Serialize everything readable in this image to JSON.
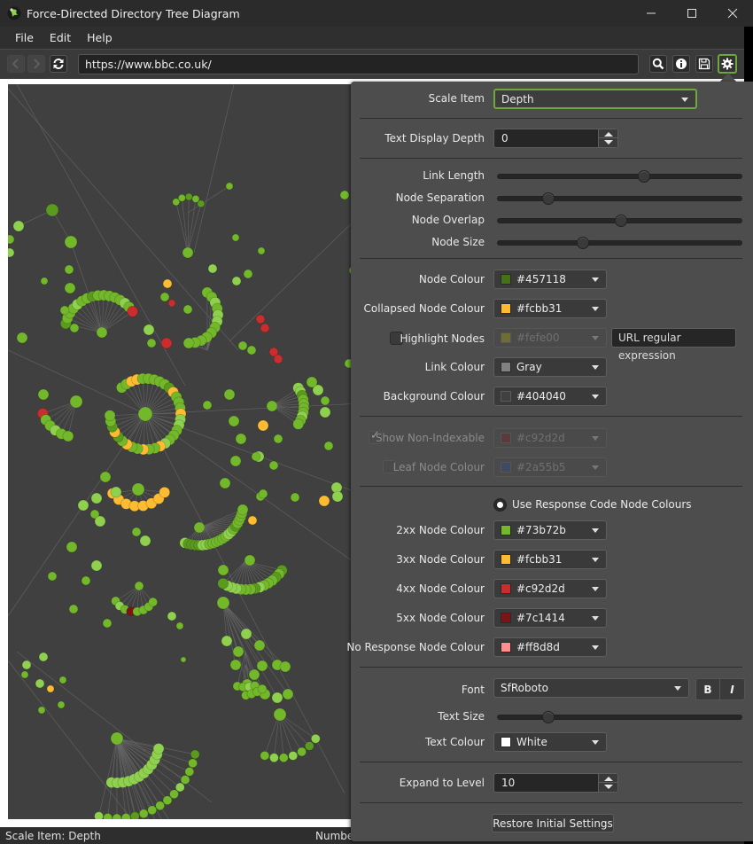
{
  "window": {
    "title": "Force-Directed Directory Tree Diagram",
    "controls": {
      "minimize": "—",
      "maximize": "☐",
      "close": "✕"
    }
  },
  "menu": [
    {
      "label": "File"
    },
    {
      "label": "Edit"
    },
    {
      "label": "Help"
    }
  ],
  "toolbar": {
    "back_icon": "‹",
    "forward_icon": "›",
    "url": "https://www.bbc.co.uk/",
    "icons": [
      "refresh-icon",
      "search-icon",
      "info-icon",
      "save-icon",
      "gear-icon"
    ]
  },
  "status": {
    "left": "Scale Item: Depth",
    "right": "Numbe"
  },
  "settings": {
    "scale_item": {
      "label": "Scale Item",
      "value": "Depth"
    },
    "text_display_depth": {
      "label": "Text Display Depth",
      "value": "0"
    },
    "sliders": [
      {
        "label": "Link Length",
        "value": 0.6
      },
      {
        "label": "Node Separation",
        "value": 0.19
      },
      {
        "label": "Node Overlap",
        "value": 0.5
      },
      {
        "label": "Node Size",
        "value": 0.34
      }
    ],
    "node_colour": {
      "label": "Node Colour",
      "value": "#457118",
      "swatch": "#457118"
    },
    "collapsed_node_colour": {
      "label": "Collapsed Node Colour",
      "value": "#fcbb31",
      "swatch": "#fcbb31"
    },
    "highlight_nodes": {
      "label": "Highlight Nodes",
      "checked": false,
      "value": "#fefe00",
      "swatch": "#6e6d33",
      "regex_placeholder": "URL regular expression"
    },
    "link_colour": {
      "label": "Link Colour",
      "value": "Gray",
      "swatch": "#808080"
    },
    "background_colour": {
      "label": "Background Colour",
      "value": "#404040",
      "swatch": "#404040"
    },
    "show_non_indexable": {
      "label": "Show Non-Indexable",
      "checked": true,
      "value": "#c92d2d",
      "swatch": "#5a3a3a"
    },
    "leaf_node_colour": {
      "label": "Leaf Node Colour",
      "checked": false,
      "value": "#2a55b5",
      "swatch": "#3e4a62"
    },
    "use_response_code": {
      "label": "Use Response Code Node Colours",
      "selected": true
    },
    "response_colours": [
      {
        "label": "2xx Node Colour",
        "value": "#73b72b",
        "swatch": "#73b72b"
      },
      {
        "label": "3xx Node Colour",
        "value": "#fcbb31",
        "swatch": "#fcbb31"
      },
      {
        "label": "4xx Node Colour",
        "value": "#c92d2d",
        "swatch": "#c92d2d"
      },
      {
        "label": "5xx Node Colour",
        "value": "#7c1414",
        "swatch": "#7c1414"
      },
      {
        "label": "No Response Node Colour",
        "value": "#ff8d8d",
        "swatch": "#ff8d8d"
      }
    ],
    "font": {
      "label": "Font",
      "value": "SfRoboto",
      "bold_label": "B",
      "italic_label": "I"
    },
    "text_size": {
      "label": "Text Size",
      "value": 0.19
    },
    "text_colour": {
      "label": "Text Colour",
      "value": "White",
      "swatch": "#ffffff"
    },
    "expand_to_level": {
      "label": "Expand to Level",
      "value": "10"
    },
    "restore_label": "Restore Initial Settings"
  },
  "graph": {
    "background": "#404040",
    "link_colour": "#6a6a6a",
    "node_colours": {
      "ok": "#73b72b",
      "ok_light": "#8fd14f",
      "ok_dark": "#5a9a1e",
      "redirect": "#fcbb31",
      "client_error": "#c92d2d",
      "server_error": "#7c1414"
    }
  }
}
